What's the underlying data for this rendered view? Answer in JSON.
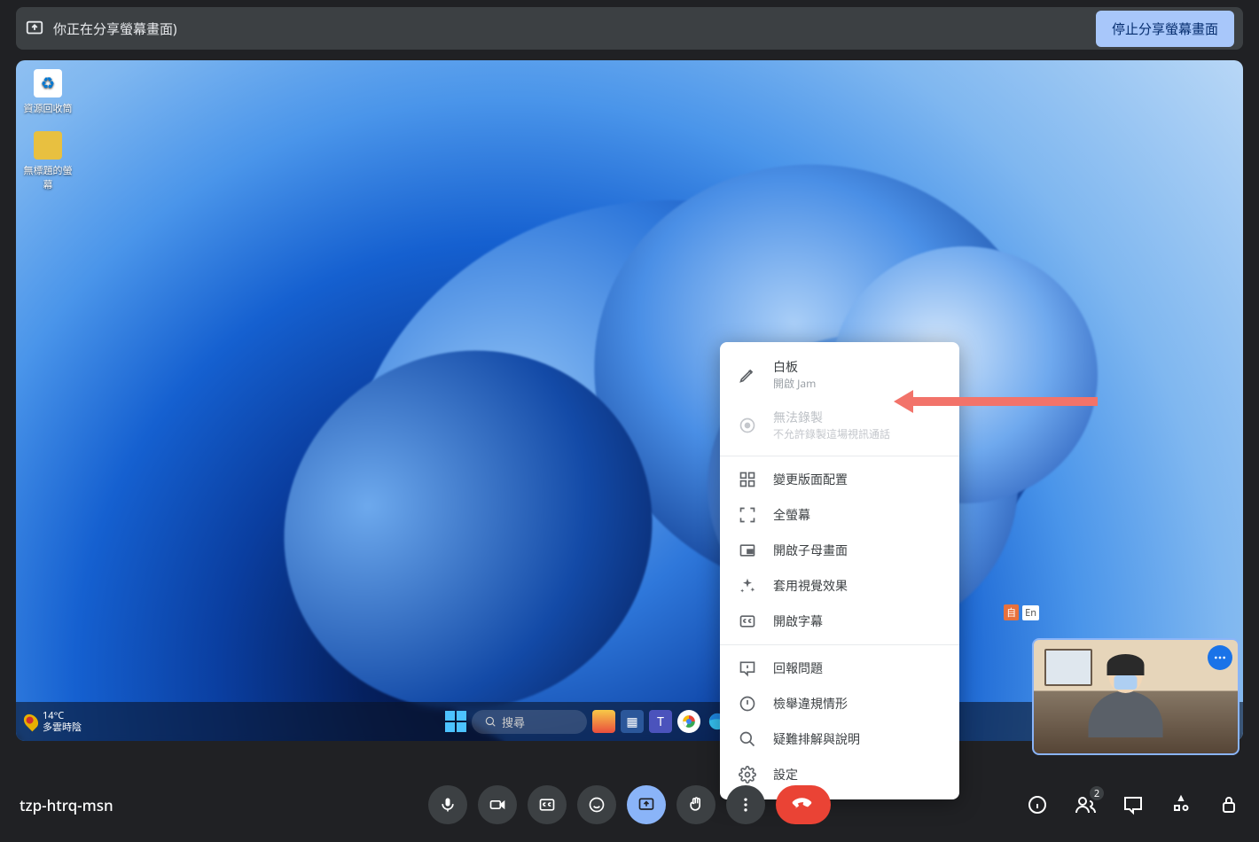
{
  "share_bar": {
    "text": "你正在分享螢幕畫面)",
    "stop_button": "停止分享螢幕畫面"
  },
  "desktop": {
    "icons": [
      {
        "label": "資源回收筒"
      },
      {
        "label": "無標題的螢幕"
      }
    ],
    "taskbar": {
      "weather_temp": "14°C",
      "weather_cond": "多雲時陰",
      "search_placeholder": "搜尋",
      "ime_auto": "自",
      "ime_en": "En"
    }
  },
  "popup": {
    "whiteboard": {
      "title": "白板",
      "sub": "開啟 Jam"
    },
    "record": {
      "title": "無法錄製",
      "sub": "不允許錄製這場視訊通話"
    },
    "layout": "變更版面配置",
    "fullscreen": "全螢幕",
    "pip": "開啟子母畫面",
    "effects": "套用視覺效果",
    "captions": "開啟字幕",
    "feedback": "回報問題",
    "abuse": "檢舉違規情形",
    "help": "疑難排解與說明",
    "settings": "設定"
  },
  "bottom": {
    "meeting_code": "tzp-htrq-msn",
    "participant_count": "2"
  }
}
